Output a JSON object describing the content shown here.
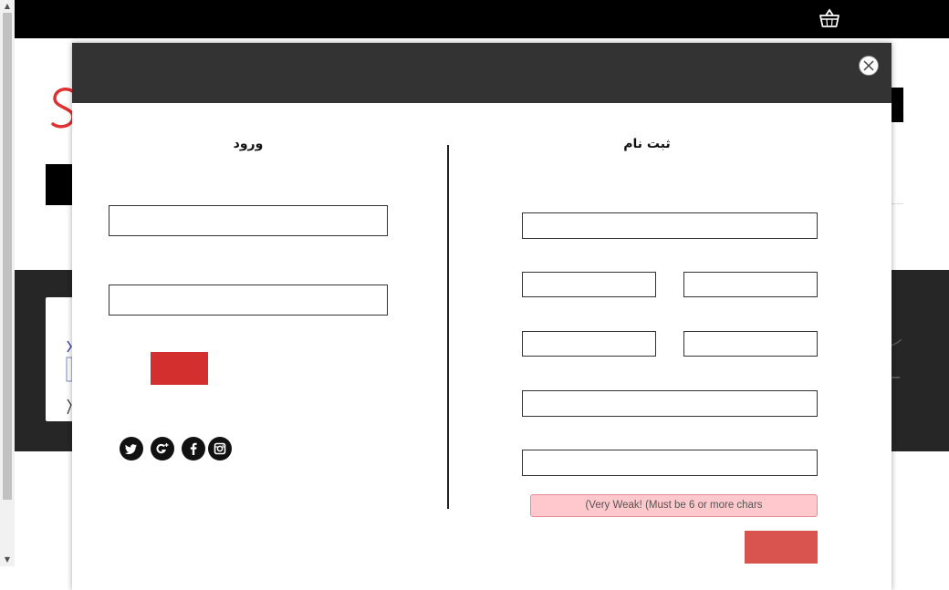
{
  "modal": {
    "login": {
      "title": "ورود",
      "username_value": "",
      "password_value": "",
      "submit_label": ""
    },
    "register": {
      "title": "ثبت نام",
      "password_strength": "(Very Weak! (Must be 6 or more chars",
      "submit_label": ""
    },
    "social_icons": [
      "twitter-icon",
      "google-plus-icon",
      "facebook-icon",
      "instagram-icon"
    ]
  },
  "icons": {
    "cart": "basket-icon",
    "close": "close-icon"
  },
  "colors": {
    "topbar": "#000000",
    "modal_header": "#333333",
    "login_button": "#d32f2f",
    "register_button": "#d9534f",
    "strength_bg": "#ffc8cc",
    "dark_band": "#262626"
  }
}
